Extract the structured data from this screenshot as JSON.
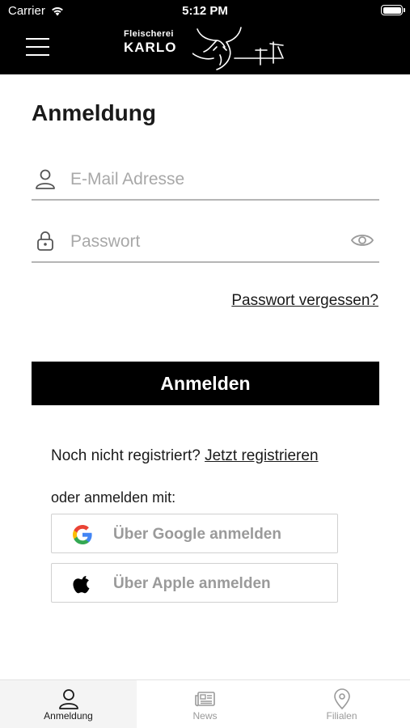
{
  "status_bar": {
    "carrier": "Carrier",
    "time": "5:12 PM"
  },
  "header": {
    "brand_small": "Fleischerei",
    "brand_big": "KARLO",
    "menu_icon": "hamburger-menu-icon"
  },
  "login": {
    "title": "Anmeldung",
    "email_placeholder": "E-Mail Adresse",
    "password_placeholder": "Passwort",
    "forgot_label": "Passwort vergessen?",
    "submit_label": "Anmelden",
    "no_account_text": "Noch nicht registriert?",
    "register_link": "Jetzt registrieren",
    "or_text": "oder anmelden mit:"
  },
  "social": {
    "google_label": "Über Google anmelden",
    "apple_label": "Über Apple anmelden"
  },
  "tabs": [
    {
      "label": "Anmeldung",
      "icon": "user-icon",
      "active": true
    },
    {
      "label": "News",
      "icon": "newspaper-icon",
      "active": false
    },
    {
      "label": "Filialen",
      "icon": "location-pin-icon",
      "active": false
    }
  ],
  "colors": {
    "header_bg": "#000000",
    "primary_button": "#000000",
    "muted_text": "#a8a8a8",
    "divider": "#b5b5b5"
  }
}
